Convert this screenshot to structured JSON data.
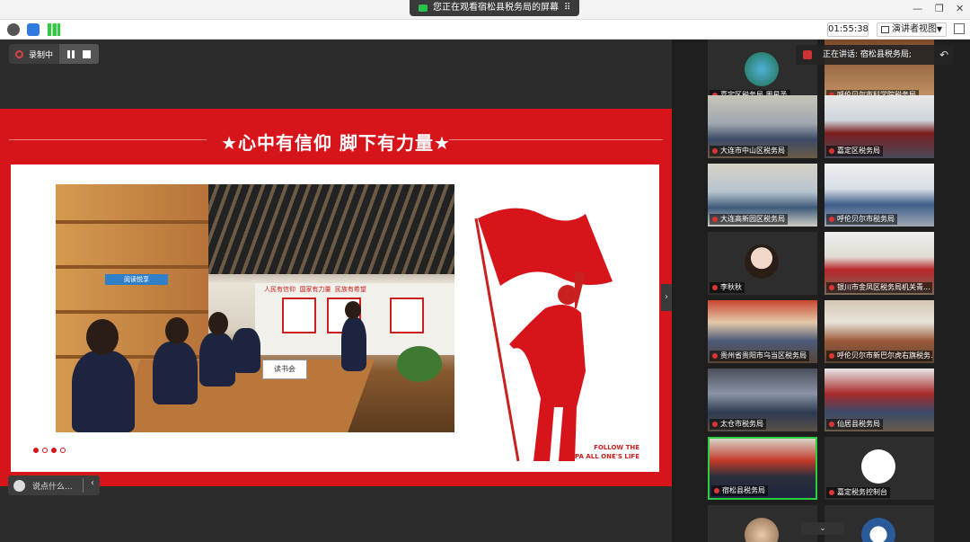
{
  "window": {
    "banner_text": "您正在观看宿松县税务局的屏幕",
    "banner_icon": "screen-share-icon"
  },
  "toolbar": {
    "timer": "01:55:38",
    "view_mode": "演讲者视图"
  },
  "recording": {
    "label": "录制中"
  },
  "slide": {
    "title": "心中有信仰 脚下有力量",
    "footer_line1": "FOLLOW THE",
    "footer_line2": "PA ALL ONE'S LIFE",
    "photo_wall_texts": [
      "人民有信仰",
      "国家有力量",
      "民族有希望"
    ],
    "photo_sign": "读书会",
    "photo_banner": "阅读悦享"
  },
  "chat": {
    "placeholder": "说点什么..."
  },
  "speaker": {
    "label": "正在讲话: 宿松县税务局;"
  },
  "participants": [
    {
      "name": "嘉定区税务局 周星圣"
    },
    {
      "name": "呼伦贝尔市科学院税务局"
    },
    {
      "name": "大连市中山区税务局"
    },
    {
      "name": "嘉定区税务局"
    },
    {
      "name": "大连高新园区税务局"
    },
    {
      "name": "呼伦贝尔市税务局"
    },
    {
      "name": "李秋秋"
    },
    {
      "name": "银川市金凤区税务局机关青..."
    },
    {
      "name": "贵州省贵阳市乌当区税务局"
    },
    {
      "name": "呼伦贝尔市新巴尔虎右旗税务..."
    },
    {
      "name": "太仓市税务局"
    },
    {
      "name": "仙居县税务局"
    },
    {
      "name": "宿松县税务局"
    },
    {
      "name": "嘉定税务控制台"
    }
  ]
}
